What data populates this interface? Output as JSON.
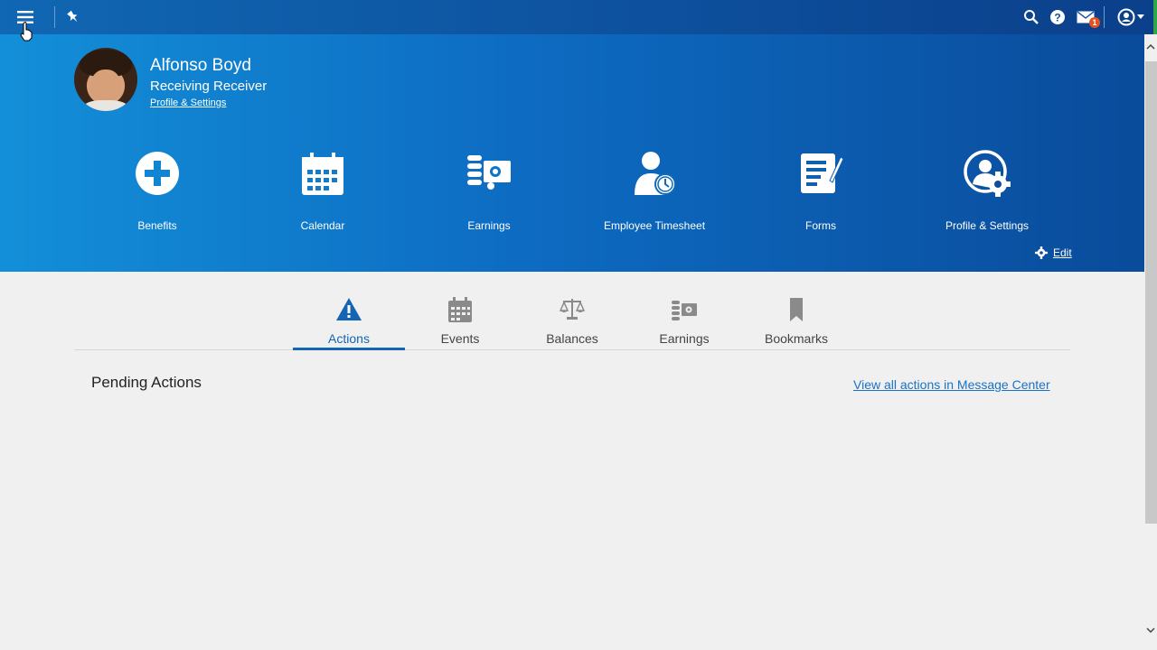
{
  "topbar": {
    "menu_icon": "hamburger-icon",
    "pin_icon": "pin-icon",
    "search_icon": "search-icon",
    "help_icon": "help-icon",
    "mail_icon": "mail-icon",
    "mail_badge": "1",
    "user_icon": "user-circle-icon"
  },
  "profile": {
    "name": "Alfonso Boyd",
    "role": "Receiving Receiver",
    "settings_link": "Profile & Settings"
  },
  "tiles": [
    {
      "label": "Benefits",
      "icon": "plus-circle-icon"
    },
    {
      "label": "Calendar",
      "icon": "calendar-icon"
    },
    {
      "label": "Earnings",
      "icon": "earnings-icon"
    },
    {
      "label": "Employee Timesheet",
      "icon": "timesheet-icon"
    },
    {
      "label": "Forms",
      "icon": "forms-icon"
    },
    {
      "label": "Profile & Settings",
      "icon": "profile-settings-icon"
    }
  ],
  "edit_label": "Edit",
  "tabs": [
    {
      "label": "Actions",
      "icon": "warning-icon",
      "active": true
    },
    {
      "label": "Events",
      "icon": "calendar-icon",
      "active": false
    },
    {
      "label": "Balances",
      "icon": "scale-icon",
      "active": false
    },
    {
      "label": "Earnings",
      "icon": "earnings-icon",
      "active": false
    },
    {
      "label": "Bookmarks",
      "icon": "bookmark-icon",
      "active": false
    }
  ],
  "pending": {
    "title": "Pending Actions",
    "view_all_link": "View all actions in Message Center"
  },
  "colors": {
    "accent": "#1565b5",
    "topbar": "#0d4f9c",
    "badge": "#e8511f"
  }
}
